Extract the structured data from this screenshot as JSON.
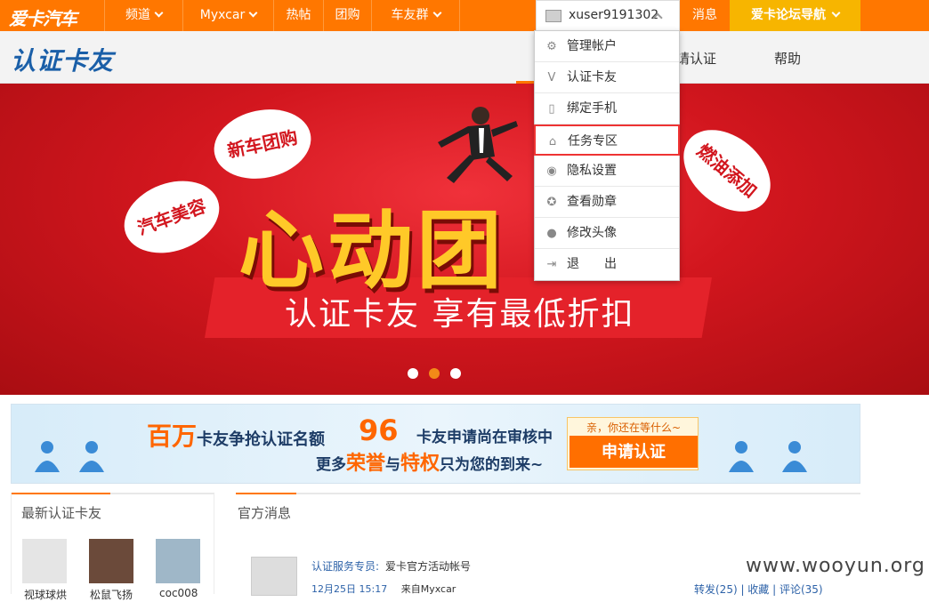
{
  "topbar": {
    "logo": "爱卡汽车",
    "nav": [
      {
        "label": "频道",
        "has_caret": true
      },
      {
        "label": "Myxcar",
        "has_caret": true
      },
      {
        "label": "热帖",
        "has_caret": false
      },
      {
        "label": "团购",
        "has_caret": false
      },
      {
        "label": "车友群",
        "has_caret": true
      }
    ],
    "username": "xuser9191302",
    "messages": "消息",
    "forum_guide": "爱卡论坛导航"
  },
  "subheader": {
    "brand": "认证卡友",
    "nav_partial": "请认证",
    "help": "帮助"
  },
  "dropdown": {
    "items": [
      {
        "label": "管理帐户",
        "icon": "gear-icon"
      },
      {
        "label": "认证卡友",
        "icon": "v-badge-icon"
      },
      {
        "label": "绑定手机",
        "icon": "phone-icon"
      },
      {
        "label": "任务专区",
        "icon": "home-icon"
      },
      {
        "label": "隐私设置",
        "icon": "eye-icon"
      },
      {
        "label": "查看勋章",
        "icon": "medal-icon"
      },
      {
        "label": "修改头像",
        "icon": "user-icon"
      },
      {
        "label": "退　　出",
        "icon": "logout-icon"
      }
    ],
    "highlighted_index": 3
  },
  "banner": {
    "badge_a": "新车团购",
    "badge_b": "汽车美容",
    "badge_c": "燃油添加",
    "headline": "心动团",
    "slogan": "认证卡友 享有最低折扣",
    "slide_count": 3,
    "active_slide": 2
  },
  "promo": {
    "big": "百万",
    "line1_a": "卡友争抢认证名额",
    "count": "96",
    "line1_b": "卡友申请尚在审核中",
    "line2_a": "更多",
    "line2_hl1": "荣誉",
    "line2_b": "与",
    "line2_hl2": "特权",
    "line2_c": "只为您的到来~",
    "apply_hint": "亲，你还在等什么~",
    "apply_button": "申请认证"
  },
  "latest_users": {
    "title": "最新认证卡友",
    "users": [
      {
        "name": "视球球烘"
      },
      {
        "name": "松鼠飞扬"
      },
      {
        "name": "coc008"
      }
    ]
  },
  "official": {
    "title": "官方消息",
    "poster": "认证服务专员:",
    "text": "爱卡官方活动帐号",
    "date": "12月25日 15:17",
    "source": "来自Myxcar",
    "actions": "转发(25) | 收藏 | 评论(35)"
  },
  "watermark": "www.wooyun.org"
}
